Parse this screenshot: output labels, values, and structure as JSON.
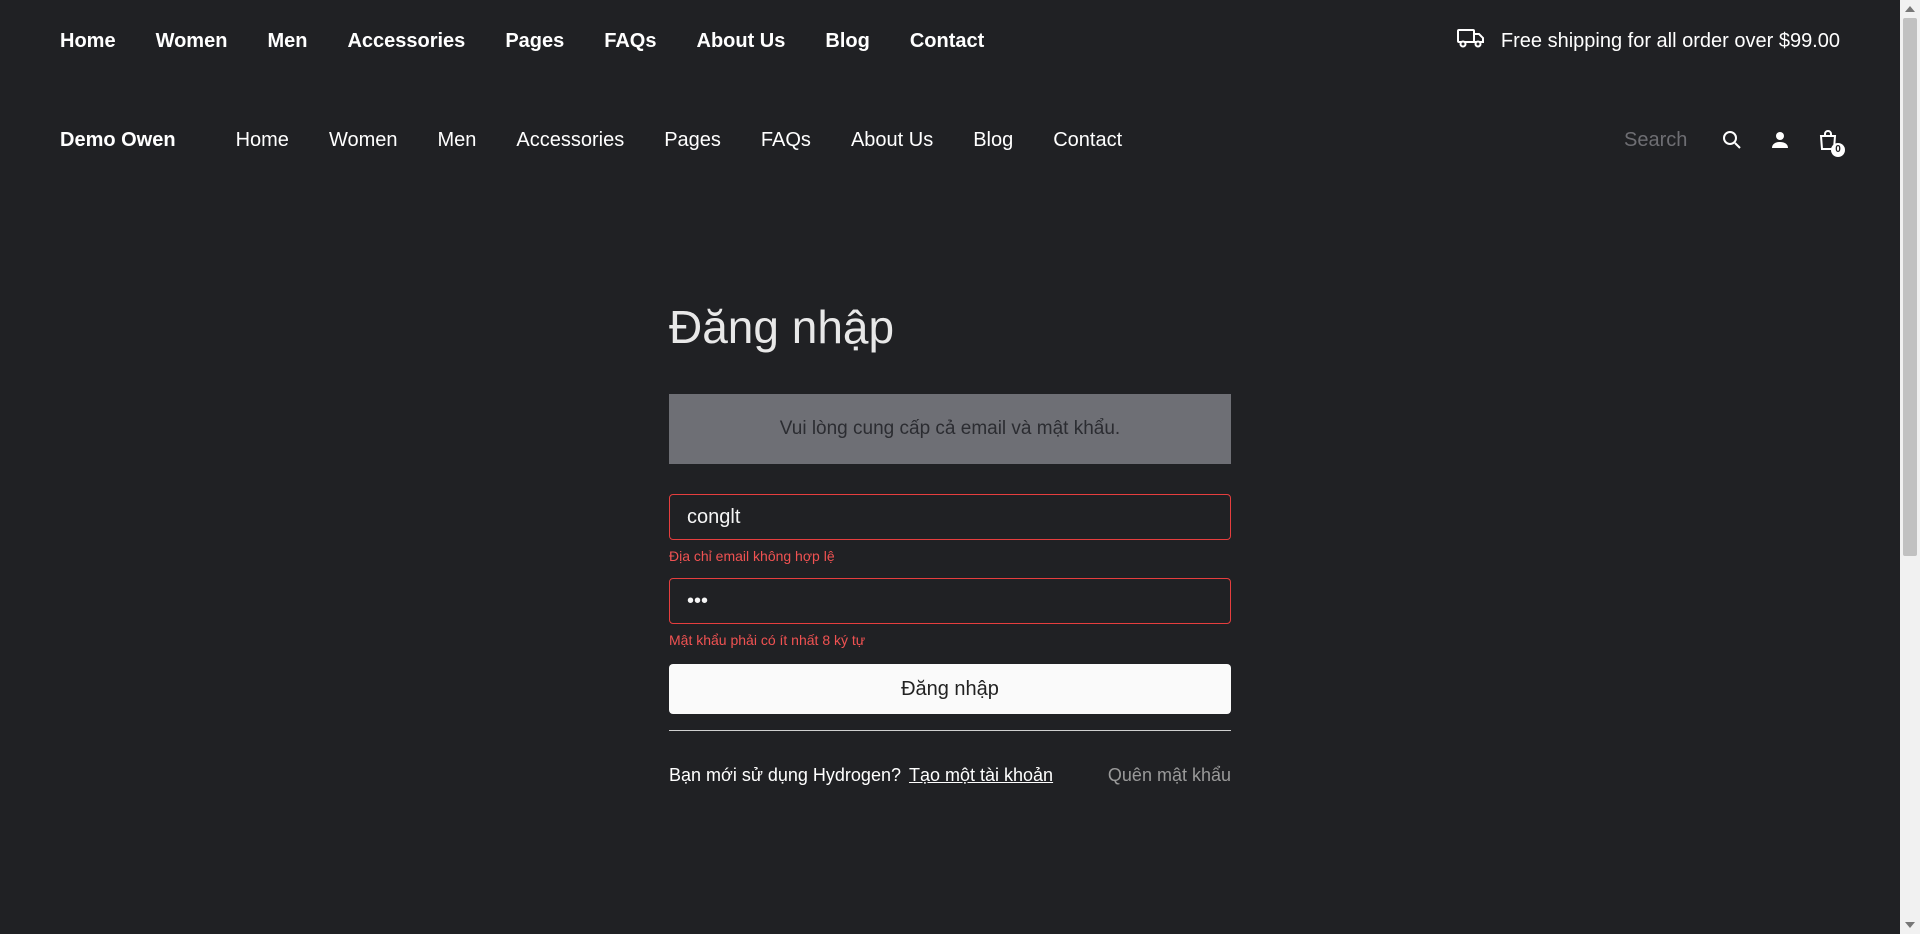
{
  "topbar": {
    "nav": [
      "Home",
      "Women",
      "Men",
      "Accessories",
      "Pages",
      "FAQs",
      "About Us",
      "Blog",
      "Contact"
    ],
    "shipping_text": "Free shipping for all order over $99.00",
    "shipping_icon": "truck-icon"
  },
  "header": {
    "brand": "Demo Owen",
    "nav": [
      "Home",
      "Women",
      "Men",
      "Accessories",
      "Pages",
      "FAQs",
      "About Us",
      "Blog",
      "Contact"
    ],
    "search_placeholder": "Search",
    "cart_count": "0",
    "icons": {
      "search": "search-icon",
      "account": "user-icon",
      "cart": "bag-icon"
    }
  },
  "login": {
    "title": "Đăng nhập",
    "alert": "Vui lòng cung cấp cả email và mật khẩu.",
    "email_value": "conglt",
    "email_error": "Địa chỉ email không hợp lệ",
    "password_value": "•••",
    "password_error": "Mật khẩu phải có ít nhất 8 ký tự",
    "submit_label": "Đăng nhập",
    "new_user_text": "Bạn mới sử dụng Hydrogen?",
    "create_account": "Tạo một tài khoản",
    "forgot_password": "Quên mật khẩu"
  },
  "colors": {
    "background": "#202124",
    "alert_bg": "#6e6f75",
    "error": "#f05252",
    "button_bg": "#fafafa"
  }
}
